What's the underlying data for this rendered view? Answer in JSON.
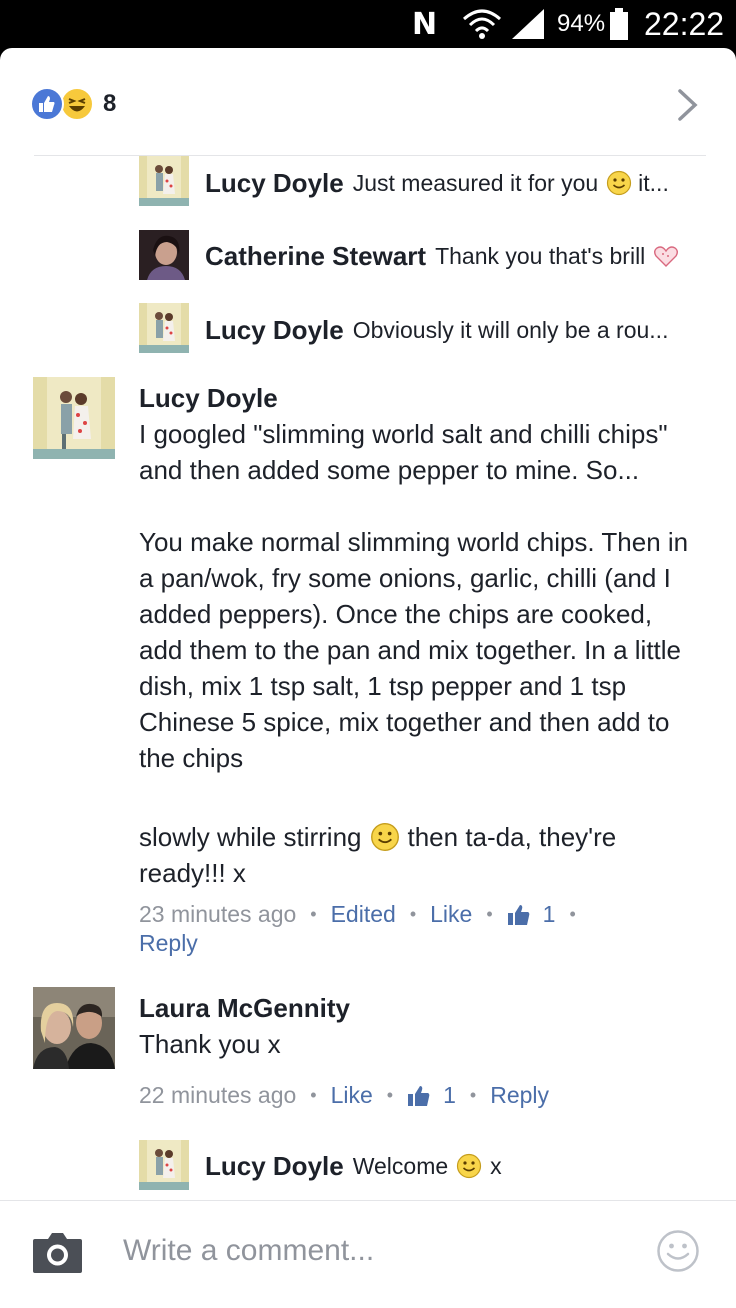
{
  "status_bar": {
    "network_icon": "n-network-icon",
    "wifi_icon": "wifi-icon",
    "signal_icon": "signal-icon",
    "battery_percent": "94%",
    "battery_icon": "battery-icon",
    "time": "22:22"
  },
  "header": {
    "reaction_icons": [
      "like-reaction-icon",
      "haha-reaction-icon"
    ],
    "reaction_count": "8",
    "chevron_icon": "chevron-right-icon"
  },
  "replies_top": [
    {
      "name": "Lucy Doyle",
      "text": "Just measured it for you",
      "suffix": "it...",
      "emoji": "smiley-emoji-icon"
    },
    {
      "name": "Catherine Stewart",
      "text": "Thank you that's brill",
      "emoji": "heart-emoji-icon"
    },
    {
      "name": "Lucy Doyle",
      "text": "Obviously it will only be a rou..."
    }
  ],
  "main_comment": {
    "name": "Lucy Doyle",
    "body_part1": "I googled \"slimming world salt and chilli chips\" and then added some pepper to mine. So...\n\nYou make normal slimming world chips. Then in a pan/wok, fry some onions, garlic, chilli (and I added peppers). Once the chips are cooked, add them to the pan and mix together. In a little dish, mix 1 tsp salt, 1 tsp pepper and 1 tsp Chinese 5 spice, mix together and then add to the chips",
    "body_line_a": "slowly while stirring",
    "body_line_b": "then ta-da, they're",
    "body_line_c": "ready!!! x",
    "time": "23 minutes ago",
    "edited": "Edited",
    "like": "Like",
    "like_count": "1",
    "reply": "Reply"
  },
  "second_comment": {
    "name": "Laura McGennity",
    "body": "Thank you x",
    "time": "22 minutes ago",
    "like": "Like",
    "like_count": "1",
    "reply": "Reply"
  },
  "reply_bottom": {
    "name": "Lucy Doyle",
    "text": "Welcome",
    "suffix": "x"
  },
  "composer": {
    "placeholder": "Write a comment...",
    "camera_icon": "camera-icon",
    "emoji_icon": "smiley-icon"
  },
  "colors": {
    "like_blue": "#4b78d6",
    "link_blue": "#4b6ea9",
    "meta_gray": "#90949c",
    "text": "#1d2129"
  }
}
